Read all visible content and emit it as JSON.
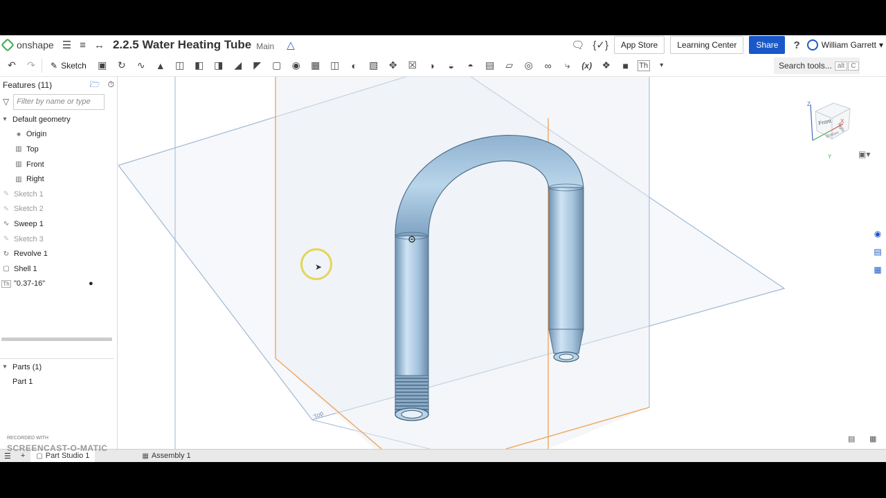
{
  "header": {
    "logo_text": "onshape",
    "doc_title": "2.2.5 Water Heating Tube",
    "branch": "Main",
    "app_store": "App Store",
    "learning_center": "Learning Center",
    "share": "Share",
    "help": "?",
    "user_name": "William Garrett"
  },
  "toolbar": {
    "sketch_label": "Sketch",
    "search_label": "Search tools...",
    "search_kbd_alt": "alt",
    "search_kbd_c": "C",
    "variable_icon": "(x)",
    "text_icon": "Th"
  },
  "features": {
    "title": "Features (11)",
    "filter_placeholder": "Filter by name or type",
    "default_geometry": "Default geometry",
    "items": [
      "Origin",
      "Top",
      "Front",
      "Right",
      "Sketch 1",
      "Sketch 2",
      "Sweep 1",
      "Sketch 3",
      "Revolve 1",
      "Shell 1",
      "\"0.37-16\""
    ],
    "thread_prefix": "Th",
    "parts_title": "Parts (1)",
    "parts": [
      "Part 1"
    ]
  },
  "viewport": {
    "plane_label": "Top",
    "view_cube": {
      "front": "Front",
      "right": "Right",
      "bottom": "Bottom",
      "x": "X",
      "y": "Y",
      "z": "Z"
    }
  },
  "tabs": {
    "part_studio": "Part Studio 1",
    "assembly": "Assembly 1"
  },
  "watermark": {
    "line1": "RECORDED WITH",
    "line2": "SCREENCAST-O-MATIC"
  },
  "colors": {
    "accent": "#1a58c7",
    "plane_orange": "#f0a050",
    "plane_blue": "#9fb7d2",
    "part_fill": "#a7c9e4",
    "logo_green": "#3fa34d"
  }
}
